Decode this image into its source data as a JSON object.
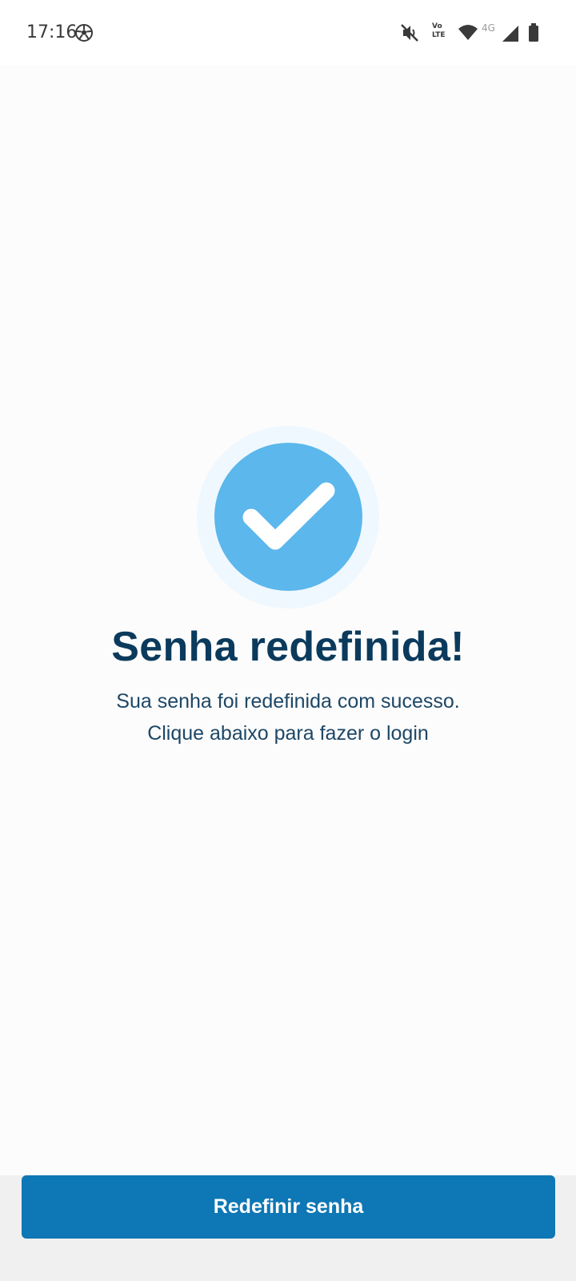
{
  "status_bar": {
    "time": "17:16",
    "network_label": "4G",
    "volte_label_top": "Vo",
    "volte_label_bottom": "LTE",
    "icons": [
      "soccer-ball-icon",
      "mute-icon",
      "volte-icon",
      "wifi-icon",
      "signal-icon",
      "battery-icon"
    ]
  },
  "success": {
    "icon": "check-icon",
    "colors": {
      "circle": "#5bb7ec",
      "halo": "#eff8fe"
    },
    "title": "Senha redefinida!",
    "message_line1": "Sua senha foi redefinida com sucesso.",
    "message_line2": "Clique abaixo para fazer o login"
  },
  "actions": {
    "primary_label": "Redefinir senha",
    "primary_color": "#0e77b5"
  }
}
